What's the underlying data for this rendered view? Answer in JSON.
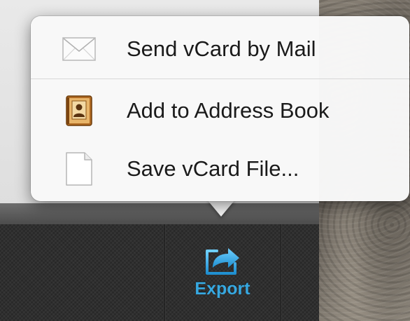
{
  "popover_menu": {
    "items": [
      {
        "label": "Send vCard by Mail",
        "icon": "mail-envelope-icon"
      },
      {
        "label": "Add to Address Book",
        "icon": "address-book-icon"
      },
      {
        "label": "Save vCard File...",
        "icon": "document-icon"
      }
    ]
  },
  "toolbar": {
    "export_label": "Export",
    "export_icon": "export-share-icon",
    "accent_color": "#37a8e0"
  }
}
